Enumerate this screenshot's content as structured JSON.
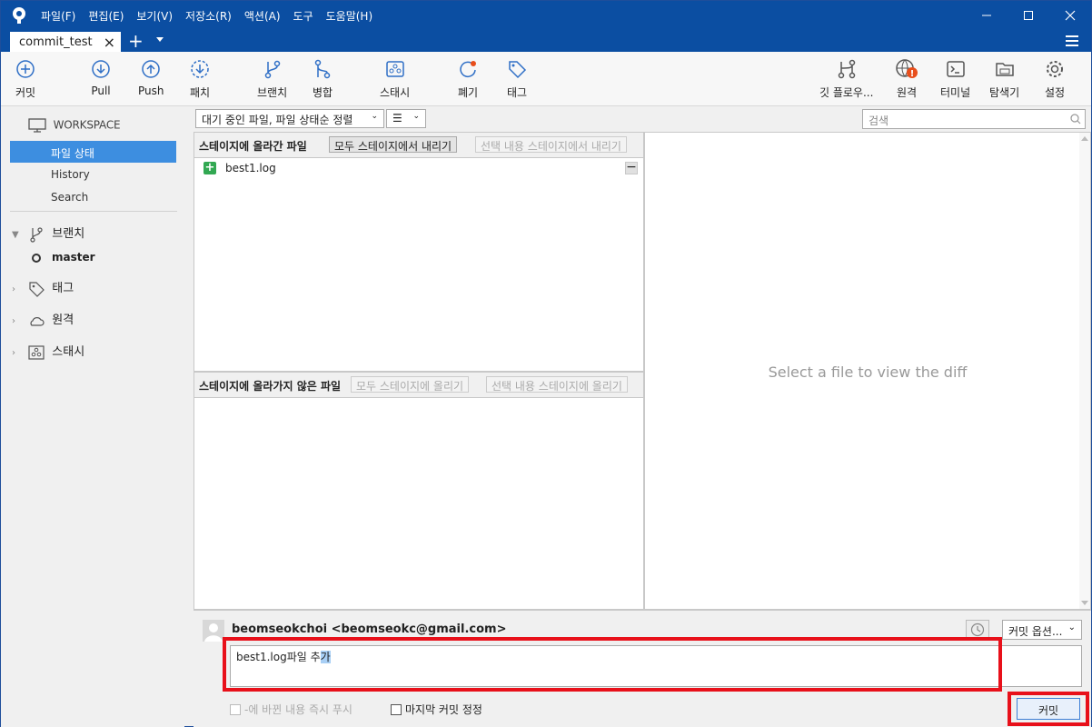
{
  "menu": [
    "파일(F)",
    "편집(E)",
    "보기(V)",
    "저장소(R)",
    "액션(A)",
    "도구",
    "도움말(H)"
  ],
  "tab": {
    "title": "commit_test"
  },
  "toolbar": {
    "commit": "커밋",
    "pull": "Pull",
    "push": "Push",
    "fetch": "패치",
    "branch": "브랜치",
    "merge": "병합",
    "stash": "스태시",
    "discard": "폐기",
    "tag": "태그",
    "gitflow": "깃 플로우...",
    "remote": "원격",
    "terminal": "터미널",
    "explorer": "탐색기",
    "settings": "설정"
  },
  "sidebar": {
    "workspace": "WORKSPACE",
    "items": [
      "파일 상태",
      "History",
      "Search"
    ],
    "branches": "브랜치",
    "current_branch": "master",
    "tags": "태그",
    "remotes": "원격",
    "stashes": "스태시"
  },
  "filter": {
    "sort": "대기 중인 파일, 파일 상태순 정렬",
    "view": "☰",
    "search_placeholder": "검색"
  },
  "staged": {
    "title": "스테이지에 올라간 파일",
    "unstage_all": "모두 스테이지에서 내리기",
    "unstage_selected": "선택 내용 스테이지에서 내리기",
    "files": [
      "best1.log"
    ]
  },
  "unstaged": {
    "title": "스테이지에 올라가지 않은 파일",
    "stage_all": "모두 스테이지에 올리기",
    "stage_selected": "선택 내용 스테이지에 올리기"
  },
  "diff": {
    "placeholder": "Select a file to view the diff"
  },
  "commit": {
    "author": "beomseokchoi <beomseokc@gmail.com>",
    "options": "커밋 옵션...",
    "message_main": "best1.log파일 추",
    "message_selected": "가",
    "push_now": "-에 바뀐 내용 즉시 푸시",
    "amend": "마지막 커밋 정정",
    "submit": "커밋"
  },
  "colors": {
    "titlebar": "#0b4ea2",
    "selected": "#3d8ee0",
    "highlight": "#e8101a",
    "remote_badge": "#e84e1b"
  }
}
